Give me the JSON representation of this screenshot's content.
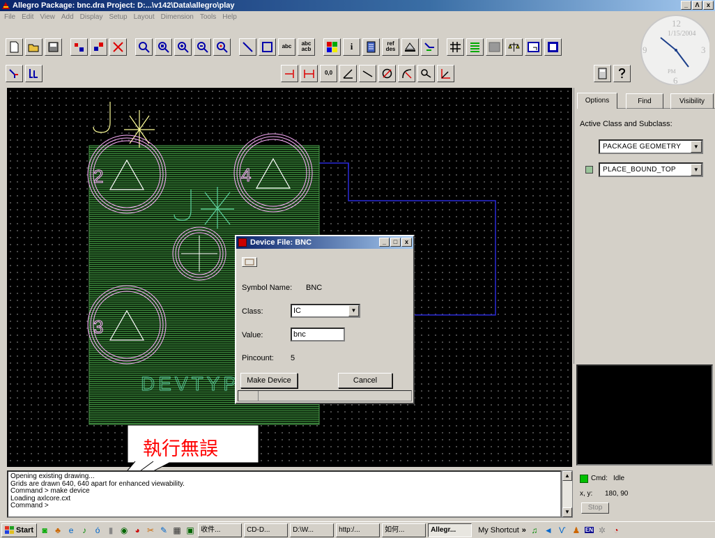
{
  "window": {
    "title": "Allegro Package: bnc.dra  Project: D:...\\v142\\Data\\allegro\\play",
    "min": "_",
    "max": "Ʌ",
    "close": "x"
  },
  "menu": [
    "File",
    "Edit",
    "View",
    "Add",
    "Display",
    "Setup",
    "Layout",
    "Dimension",
    "Tools",
    "Help"
  ],
  "toolbar_text": {
    "abc_add": "abc",
    "abc_swap_top": "abc",
    "abc_swap_bottom": "acb",
    "info": "i",
    "refdes_top": "ref",
    "refdes_bottom": "des",
    "dim": "0,0"
  },
  "clock": {
    "twelve": "12",
    "three": "3",
    "six": "6",
    "nine": "9",
    "date": "1/15/2004",
    "ampm": "PM"
  },
  "canvas": {
    "pad_labels": [
      "2",
      "4",
      "3"
    ],
    "refdes": "J",
    "devtype": "DEVTYPE",
    "colors": {
      "outline": "#ffb0ff",
      "body": "#2e6b2e",
      "text": "#ffff99",
      "devtype": "#5fd0a0",
      "route": "#2a2ad8"
    }
  },
  "panel": {
    "tabs": [
      "Options",
      "Find",
      "Visibility"
    ],
    "active_label": "Active Class and Subclass:",
    "class_value": "PACKAGE GEOMETRY",
    "subclass_value": "PLACE_BOUND_TOP"
  },
  "dialog": {
    "title": "Device File: BNC",
    "symbol_label": "Symbol Name:",
    "symbol_value": "BNC",
    "class_label": "Class:",
    "class_value": "IC",
    "value_label": "Value:",
    "value_value": "bnc",
    "pincount_label": "Pincount:",
    "pincount_value": "5",
    "make_device": "Make Device",
    "cancel": "Cancel"
  },
  "callout": {
    "text": "執行無誤"
  },
  "command": {
    "lines": [
      "Opening existing drawing...",
      "Grids are drawn 640, 640 apart for enhanced viewability.",
      "Command > make device",
      "Loading axlcore.cxt",
      "Command >"
    ]
  },
  "status": {
    "cmd_label": "Cmd:",
    "cmd_value": "Idle",
    "xy_label": "x, y:",
    "xy_value": "180, 90",
    "stop": "Stop"
  },
  "taskbar": {
    "start": "Start",
    "tasks": [
      "收件...",
      "CD-D...",
      "D:\\W...",
      "http:/...",
      "如何...",
      "Allegr..."
    ],
    "shortcut": "My Shortcut",
    "chevron": "»",
    "tray_lang": "EN"
  }
}
